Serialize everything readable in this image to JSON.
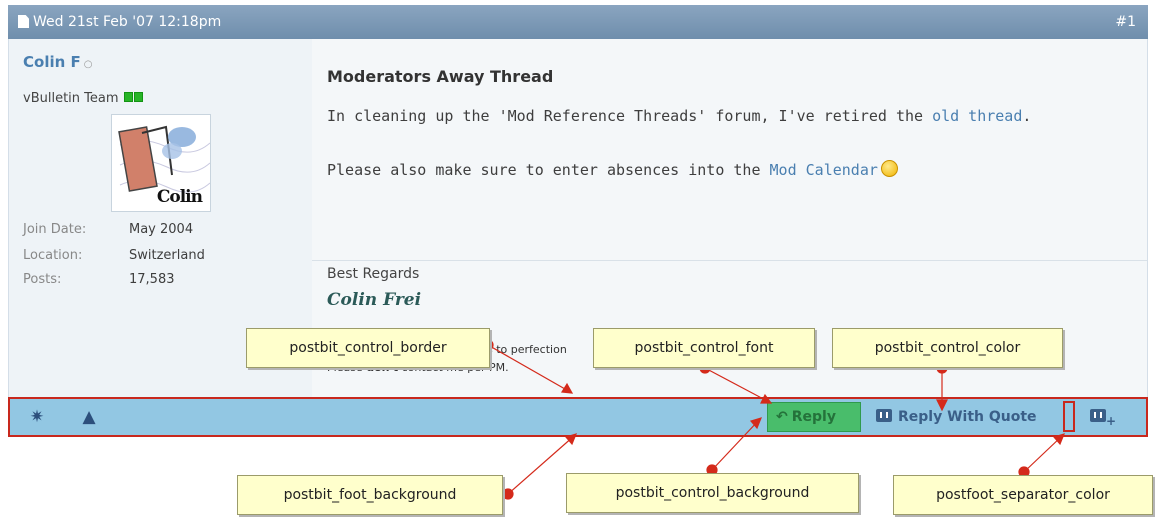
{
  "post": {
    "date": "Wed 21st Feb '07 12:18pm",
    "number": "#1"
  },
  "user": {
    "name": "Colin F",
    "online_status": "○",
    "title": "vBulletin Team",
    "avatar_text": "Colin",
    "stats": [
      {
        "label": "Join Date:",
        "value": "May 2004"
      },
      {
        "label": "Location:",
        "value": "Switzerland"
      },
      {
        "label": "Posts:",
        "value": "17,583"
      }
    ]
  },
  "message": {
    "title": "Moderators Away Thread",
    "line1_text": "In cleaning up the 'Mod Reference Threads' forum, I've retired the ",
    "line1_link": "old thread",
    "line1_end": ".",
    "line2_text": "Please also make sure to enter absences into the ",
    "line2_link": "Mod Calendar"
  },
  "signature": {
    "regards": "Best Regards",
    "name": "Colin Frei",
    "line1_partial": "s to perfection",
    "line1_partial2": "isi",
    "line2_prefix": "Please ",
    "line2_bold": "don't",
    "line2_suffix": " contact me per PM."
  },
  "footer": {
    "reply_label": "Reply",
    "quote_label": "Reply With Quote",
    "icons": [
      "star-icon",
      "warning-icon",
      "reply-icon",
      "quote-icon",
      "multiquote-icon"
    ]
  },
  "annotations": {
    "control_border": "postbit_control_border",
    "control_font": "postbit_control_font",
    "control_color": "postbit_control_color",
    "foot_background": "postbit_foot_background",
    "control_background": "postbit_control_background",
    "separator_color": "postfoot_separator_color"
  },
  "colors": {
    "header": "#7b97b3",
    "foot_background": "#92c7e3",
    "control_background": "#49bd6b",
    "annotation_border": "#c8281d",
    "callout_fill": "#ffffcc",
    "link": "#4a7fb0"
  }
}
